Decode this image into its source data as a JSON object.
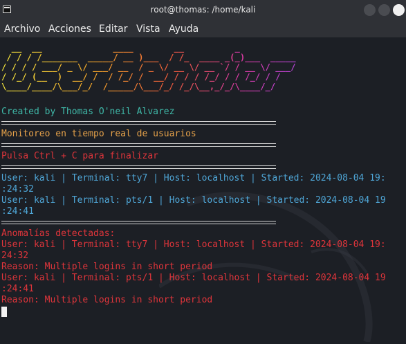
{
  "window": {
    "title": "root@thomas: /home/kali"
  },
  "menu": {
    "archivo": "Archivo",
    "acciones": "Acciones",
    "editar": "Editar",
    "vista": "Vista",
    "ayuda": "Ayuda"
  },
  "terminal": {
    "banner_lines": [
      "  __  __              ____        __          _         ",
      " / / / /_______  _____/ __ )___  / /_  ____ _(_)___  _____",
      "/ / / / ___/ _ \\/ ___/ __  / _ \\/ __ \\/ __ `/ / __ \\/ ___/",
      "/ /_/ (__  )  __/ /  / /_/ /  __/ / / / /_/ / / /_/ / /  ",
      "\\____/____/\\___/_/  /_____/\\___/_/ /_/\\__,_/_/\\____/_/   "
    ],
    "credit": "Created by Thomas O'neil Álvarez",
    "monitor_heading": "Monitoreo en tiempo real de usuarios",
    "exit_hint": "Pulsa Ctrl + C para finalizar",
    "sessions": [
      "User: kali | Terminal: tty7 | Host: localhost | Started: 2024-08-04 19:",
      ":24:32",
      "User: kali | Terminal: pts/1 | Host: localhost | Started: 2024-08-04 19",
      ":24:41"
    ],
    "anomalies_heading": "Anomalías detectadas:",
    "anomalies": [
      "User: kali | Terminal: tty7 | Host: localhost | Started: 2024-08-04 19:",
      "24:32",
      "Reason: Multiple logins in short period",
      "User: kali | Terminal: pts/1 | Host: localhost | Started: 2024-08-04 19",
      ":24:41",
      "Reason: Multiple logins in short period"
    ]
  },
  "colors": {
    "green": "#3fb8a8",
    "orange": "#e6a24a",
    "red": "#e0353b",
    "blue": "#4fa7d8"
  }
}
